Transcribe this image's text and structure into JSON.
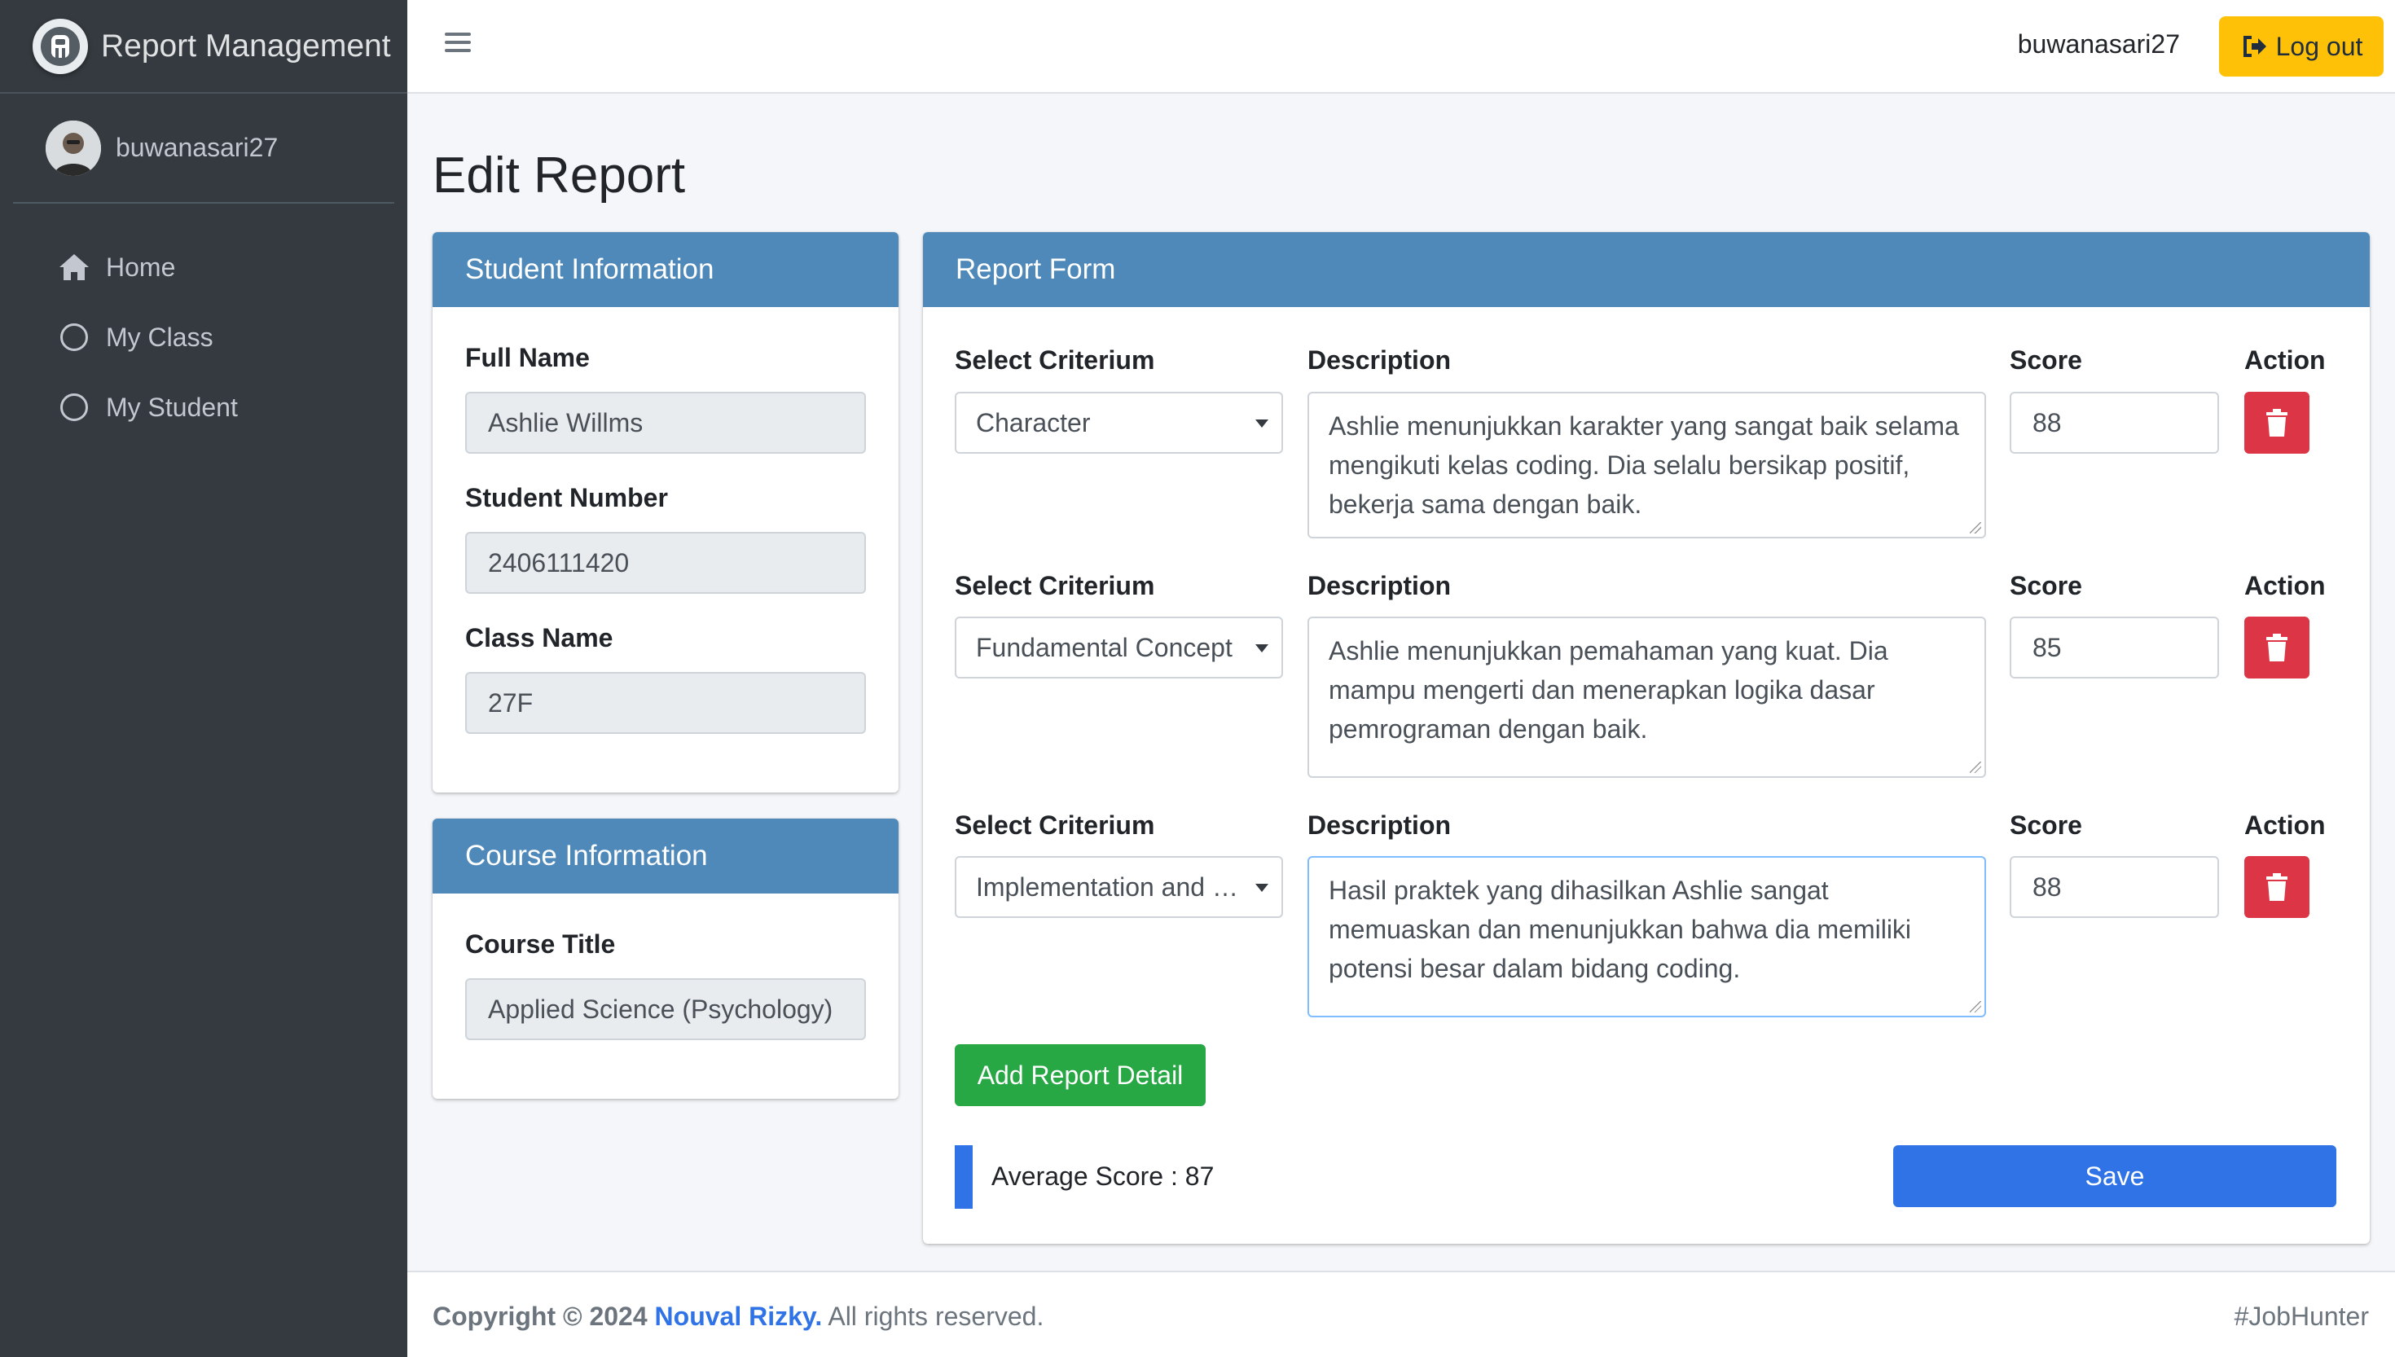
{
  "app": {
    "title": "Report Management"
  },
  "user": {
    "name": "buwanasari27"
  },
  "sidebar": {
    "items": [
      {
        "label": "Home",
        "icon": "home-icon"
      },
      {
        "label": "My Class",
        "icon": "circle-icon"
      },
      {
        "label": "My Student",
        "icon": "circle-icon"
      }
    ]
  },
  "topbar": {
    "username": "buwanasari27",
    "logout_label": "Log out"
  },
  "page": {
    "title": "Edit Report"
  },
  "student_info": {
    "header": "Student Information",
    "full_name_label": "Full Name",
    "full_name": "Ashlie Willms",
    "student_number_label": "Student Number",
    "student_number": "2406111420",
    "class_name_label": "Class Name",
    "class_name": "27F"
  },
  "course_info": {
    "header": "Course Information",
    "course_title_label": "Course Title",
    "course_title": "Applied Science (Psychology)"
  },
  "report_form": {
    "header": "Report Form",
    "col_criterium": "Select Criterium",
    "col_description": "Description",
    "col_score": "Score",
    "col_action": "Action",
    "rows": [
      {
        "criterium": "Character",
        "description": "Ashlie menunjukkan karakter yang sangat baik selama mengikuti kelas coding. Dia selalu bersikap positif, bekerja sama dengan baik.",
        "score": "88"
      },
      {
        "criterium": "Fundamental Concept",
        "description": "Ashlie menunjukkan pemahaman yang kuat. Dia mampu mengerti dan menerapkan logika dasar pemrograman dengan baik.",
        "score": "85"
      },
      {
        "criterium": "Implementation and Problem Solving",
        "description": "Hasil praktek yang dihasilkan Ashlie sangat memuaskan dan menunjukkan bahwa dia memiliki potensi besar dalam bidang coding.",
        "score": "88"
      }
    ],
    "add_label": "Add Report Detail",
    "average_label": "Average Score : 87",
    "save_label": "Save"
  },
  "footer": {
    "copyright": "Copyright © 2024",
    "author": "Nouval Rizky.",
    "rights": "All rights reserved.",
    "tag": "#JobHunter"
  },
  "colors": {
    "sidebar_bg": "#343a40",
    "card_header": "#4f89b9",
    "primary": "#2f73e6",
    "success": "#28a745",
    "danger": "#dc3545",
    "warning": "#ffc107"
  }
}
